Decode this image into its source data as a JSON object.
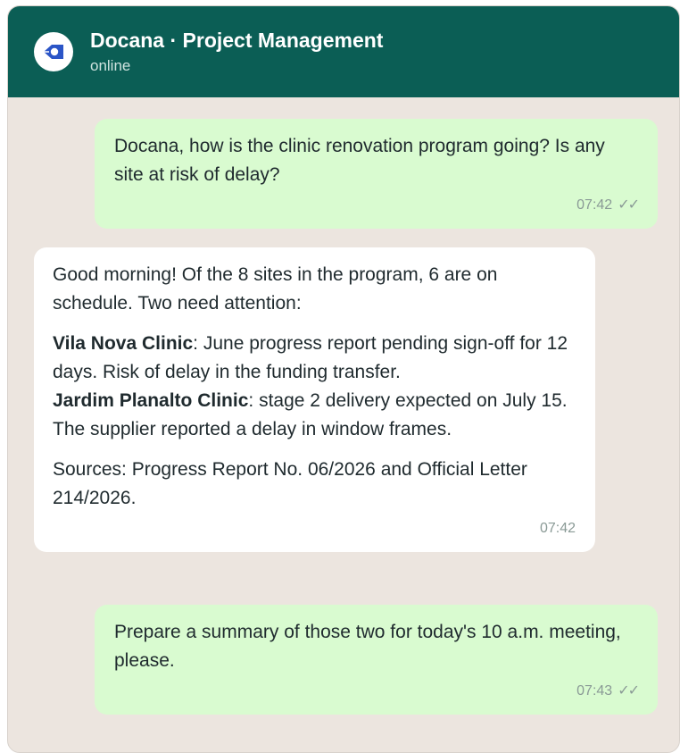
{
  "header": {
    "title": "Docana · Project Management",
    "status": "online",
    "avatar_icon": "docana-logo-icon"
  },
  "messages": [
    {
      "direction": "outgoing",
      "text": "Docana, how is the clinic renovation program going? Is any site at risk of delay?",
      "time": "07:42",
      "ticks": "✓✓"
    },
    {
      "direction": "incoming",
      "intro": "Good morning! Of the 8 sites in the program, 6 are on schedule. Two need attention:",
      "site1_name": "Vila Nova Clinic",
      "site1_text": ": June progress report pending sign-off for 12 days. Risk of delay in the funding transfer.",
      "site2_name": "Jardim Planalto Clinic",
      "site2_text": ": stage 2 delivery expected on July 15. The supplier reported a delay in window frames.",
      "sources": "Sources: Progress Report No. 06/2026 and Official Letter 214/2026.",
      "time": "07:42"
    },
    {
      "direction": "outgoing",
      "text": "Prepare a summary of those two for today's 10 a.m. meeting, please.",
      "time": "07:43",
      "ticks": "✓✓"
    }
  ],
  "colors": {
    "header_bg": "#0b5e55",
    "chat_bg": "#ece5df",
    "outgoing_bubble": "#d9fbd0",
    "incoming_bubble": "#ffffff",
    "logo_blue": "#2b55c7"
  }
}
